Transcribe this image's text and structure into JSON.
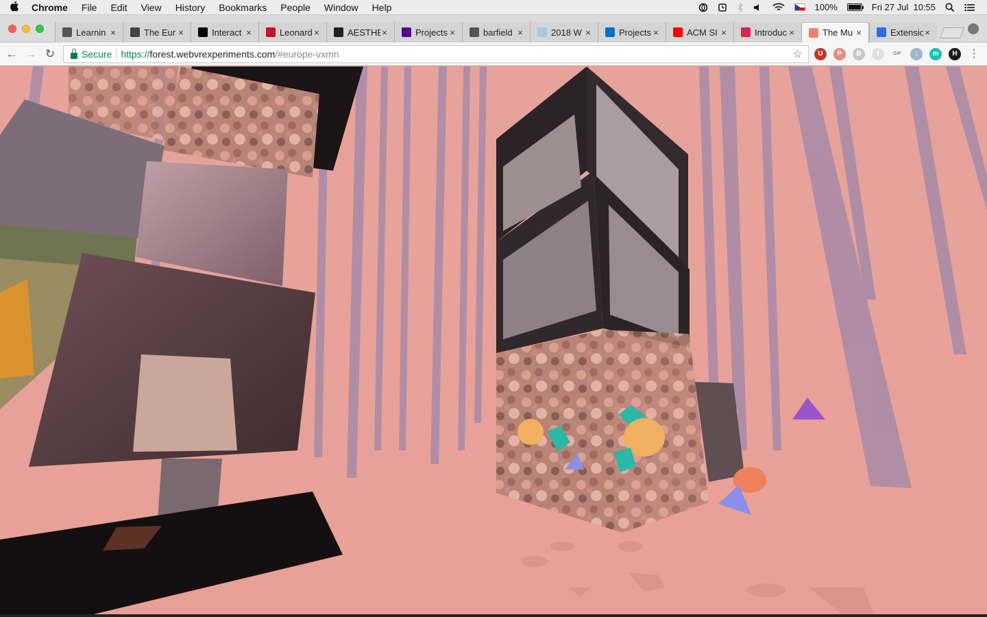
{
  "menubar": {
    "app_name": "Chrome",
    "items": [
      "File",
      "Edit",
      "View",
      "History",
      "Bookmarks",
      "People",
      "Window",
      "Help"
    ],
    "battery_text": "100%",
    "battery_level": 1.0,
    "datetime": "Fri 27 Jul  10:55",
    "status_icons": [
      "opera-icon",
      "alarm-icon",
      "bluetooth-icon",
      "volume-icon",
      "wifi-icon",
      "czech-flag-icon"
    ]
  },
  "tabs": [
    {
      "title": "Learnin",
      "icon": "doc-icon",
      "color": "#555555"
    },
    {
      "title": "The Eur",
      "icon": "site-icon",
      "color": "#444444"
    },
    {
      "title": "Interact",
      "icon": "square-icon",
      "color": "#000000"
    },
    {
      "title": "Leonard",
      "icon": "l-icon",
      "color": "#c8102e"
    },
    {
      "title": "AESTHE",
      "icon": "three-icon",
      "color": "#222222"
    },
    {
      "title": "Projects",
      "icon": "itp-icon",
      "color": "#57068c"
    },
    {
      "title": "barfield",
      "icon": "doc-icon",
      "color": "#555555"
    },
    {
      "title": "2018 W",
      "icon": "globe-icon",
      "color": "#a8c8e8"
    },
    {
      "title": "Projects",
      "icon": "intel-icon",
      "color": "#0071c5"
    },
    {
      "title": "ACM SI",
      "icon": "youtube-icon",
      "color": "#ff0000"
    },
    {
      "title": "Introduc",
      "icon": "a-icon",
      "color": "#d6274f"
    },
    {
      "title": "The Mu",
      "icon": "forest-icon",
      "color": "#f08070",
      "active": true
    },
    {
      "title": "Extensio",
      "icon": "puzzle-icon",
      "color": "#2a6ee8"
    }
  ],
  "tab_close_glyph": "×",
  "toolbar": {
    "back": "←",
    "forward": "→",
    "reload": "↻",
    "secure_label": "Secure",
    "url_scheme": "https://",
    "url_host": "forest.webvrexperiments.com",
    "url_path": "/#europe-vxmn",
    "star": "☆",
    "menu": "⋮"
  },
  "extensions": [
    {
      "name": "ublock-icon",
      "color": "#c0392b",
      "glyph": "U"
    },
    {
      "name": "pinterest-icon",
      "color": "#e88a80",
      "glyph": "P"
    },
    {
      "name": "b-icon",
      "color": "#c8c8c8",
      "glyph": "B"
    },
    {
      "name": "f-icon",
      "color": "#e0e0e0",
      "glyph": "f"
    },
    {
      "name": "stop-gif-icon",
      "color": "#bdbdbd",
      "glyph": "GIF"
    },
    {
      "name": "download-icon",
      "color": "#9fb7c9",
      "glyph": "↓"
    },
    {
      "name": "m-icon",
      "color": "#1fbfb0",
      "glyph": "m"
    },
    {
      "name": "h-icon",
      "color": "#1a1a1a",
      "glyph": "H"
    }
  ],
  "colors": {
    "scene_bg": "#e7a196",
    "tree": "#a68aa8",
    "teal": "#2bb8a6",
    "orange_ball": "#f0b060",
    "purple": "#9b55c9",
    "blue_tri": "#8b8fe8"
  }
}
